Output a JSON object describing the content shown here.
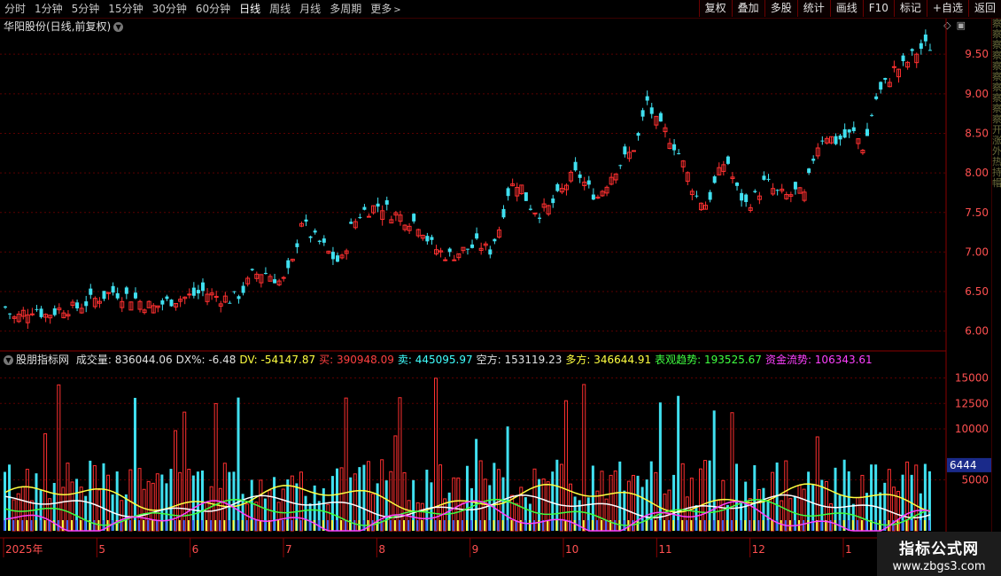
{
  "toolbar": {
    "periods": [
      "分时",
      "1分钟",
      "5分钟",
      "15分钟",
      "30分钟",
      "60分钟",
      "日线",
      "周线",
      "月线",
      "多周期",
      "更多"
    ],
    "active_index": 6,
    "buttons": [
      "复权",
      "叠加",
      "多股",
      "统计",
      "画线",
      "F10",
      "标记",
      "+自选",
      "返回"
    ]
  },
  "main_panel": {
    "title": "华阳股份(日线,前复权)",
    "price_axis": [
      "9.50",
      "9.00",
      "8.50",
      "8.00",
      "7.50",
      "7.00",
      "6.50",
      "6.00"
    ],
    "price_range": [
      5.75,
      9.95
    ]
  },
  "side_strip": [
    "察",
    "察",
    "察",
    "察",
    "察",
    "察",
    "察",
    "察",
    "察",
    "察",
    "开",
    "涨",
    "外",
    "热",
    "持",
    "帽"
  ],
  "indicator": {
    "name": "股朋指标网",
    "values": [
      {
        "label": "成交量: 836044.06",
        "color": "#e0e0e0"
      },
      {
        "label": "DX%: -6.48",
        "color": "#e0e0e0"
      },
      {
        "label": "DV: -54147.87",
        "color": "#ffff40"
      },
      {
        "label": "买: 390948.09",
        "color": "#ff4040"
      },
      {
        "label": "卖: 445095.97",
        "color": "#40ffff"
      },
      {
        "label": "空方: 153119.23",
        "color": "#e0e0e0"
      },
      {
        "label": "多方: 346644.91",
        "color": "#ffff40"
      },
      {
        "label": "表观趋势: 193525.67",
        "color": "#40ff40"
      },
      {
        "label": "资金流势: 106343.61",
        "color": "#ff40ff"
      }
    ],
    "axis": [
      "15000",
      "12500",
      "10000",
      "5000"
    ],
    "highlight_value": "6444",
    "vol_range": [
      0,
      16000
    ]
  },
  "date_axis": [
    "2025年",
    "5",
    "6",
    "7",
    "8",
    "9",
    "10",
    "11",
    "12",
    "1"
  ],
  "watermark": {
    "line1": "指标公式网",
    "line2": "www.zbgs3.com"
  },
  "colors": {
    "up": "#ff3030",
    "down": "#40e0f0",
    "grid": "#5a0000"
  },
  "chart_data": {
    "type": "candlestick",
    "title": "华阳股份(日线,前复权)",
    "y_ticks": [
      6.0,
      6.5,
      7.0,
      7.5,
      8.0,
      8.5,
      9.0,
      9.5
    ],
    "close_series": [
      6.3,
      6.15,
      6.25,
      6.3,
      6.2,
      6.25,
      6.3,
      6.28,
      6.35,
      6.4,
      6.45,
      6.5,
      6.45,
      6.42,
      6.35,
      6.3,
      6.35,
      6.4,
      6.42,
      6.45,
      6.5,
      6.45,
      6.42,
      6.4,
      6.5,
      6.7,
      6.75,
      6.7,
      6.6,
      6.8,
      7.4,
      7.2,
      7.1,
      6.95,
      6.85,
      7.3,
      7.5,
      7.55,
      7.6,
      7.5,
      7.45,
      7.4,
      7.35,
      7.1,
      7.0,
      6.95,
      7.0,
      7.05,
      7.1,
      7.0,
      7.3,
      7.8,
      7.9,
      7.6,
      7.5,
      7.55,
      7.7,
      7.9,
      8.0,
      7.8,
      7.7,
      7.9,
      8.1,
      8.2,
      8.4,
      8.9,
      8.6,
      8.5,
      8.3,
      8.0,
      7.7,
      7.6,
      7.9,
      8.2,
      7.8,
      7.6,
      7.7,
      7.9,
      7.75,
      7.7,
      7.75,
      7.7,
      8.3,
      8.5,
      8.4,
      8.45,
      8.5,
      8.3,
      8.9,
      9.1,
      9.3,
      9.35,
      9.5,
      9.6
    ]
  }
}
